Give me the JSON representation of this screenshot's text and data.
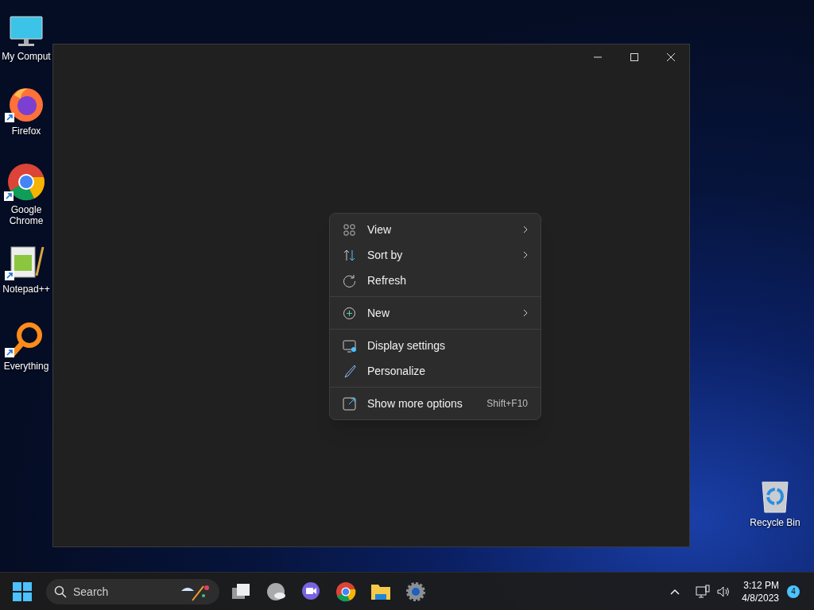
{
  "desktop_icons": [
    {
      "label": "My Comput",
      "kind": "computer",
      "shortcut": false
    },
    {
      "label": "Firefox",
      "kind": "firefox",
      "shortcut": true
    },
    {
      "label": "Google Chrome",
      "kind": "chrome",
      "shortcut": true
    },
    {
      "label": "Notepad++",
      "kind": "notepad",
      "shortcut": true
    },
    {
      "label": "Everything",
      "kind": "everything",
      "shortcut": true
    },
    {
      "label": "Recycle Bin",
      "kind": "recycle",
      "shortcut": false
    }
  ],
  "window": {
    "controls": [
      {
        "kind": "minimize"
      },
      {
        "kind": "maximize"
      },
      {
        "kind": "close"
      }
    ]
  },
  "context_menu": {
    "groups": [
      [
        {
          "label": "View",
          "kind": "grid",
          "submenu": true
        },
        {
          "label": "Sort by",
          "kind": "sort",
          "submenu": true
        },
        {
          "label": "Refresh",
          "kind": "refresh",
          "submenu": false
        }
      ],
      [
        {
          "label": "New",
          "kind": "plus",
          "submenu": true
        }
      ],
      [
        {
          "label": "Display settings",
          "kind": "display",
          "submenu": false
        },
        {
          "label": "Personalize",
          "kind": "brush",
          "submenu": false
        }
      ],
      [
        {
          "label": "Show more options",
          "kind": "expand",
          "submenu": false,
          "shortcut": "Shift+F10"
        }
      ]
    ]
  },
  "taskbar": {
    "search": {
      "placeholder": "Search"
    },
    "apps": [
      {
        "kind": "taskview"
      },
      {
        "kind": "weather"
      },
      {
        "kind": "meet"
      },
      {
        "kind": "chrome"
      },
      {
        "kind": "explorer"
      },
      {
        "kind": "settings"
      }
    ],
    "tray": {
      "time": "3:12 PM",
      "date": "4/8/2023",
      "notifications": "4"
    }
  }
}
